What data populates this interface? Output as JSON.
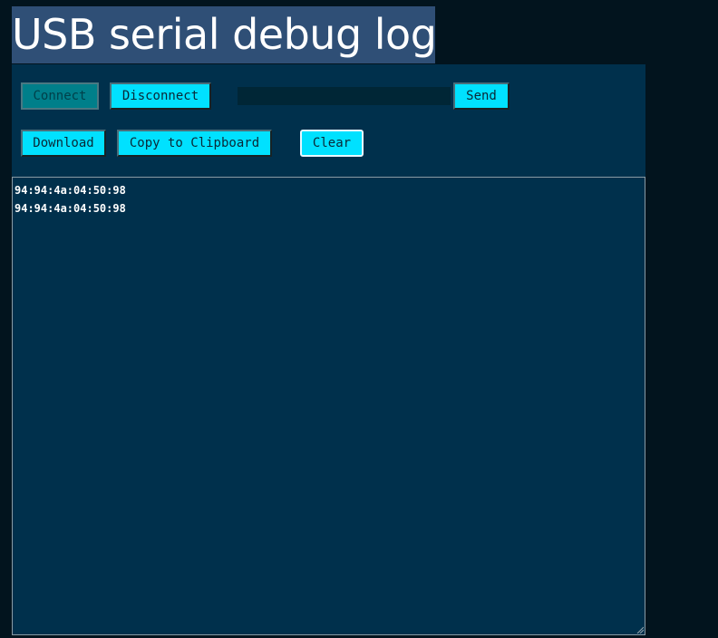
{
  "page": {
    "title": "USB serial debug log"
  },
  "controls": {
    "connect_label": "Connect",
    "disconnect_label": "Disconnect",
    "send_input_value": "",
    "send_label": "Send",
    "download_label": "Download",
    "copy_label": "Copy to Clipboard",
    "clear_label": "Clear"
  },
  "log": {
    "lines": [
      "94:94:4a:04:50:98",
      "94:94:4a:04:50:98"
    ]
  },
  "colors": {
    "page_background": "#02141e",
    "panel_background": "#00304c",
    "title_highlight": "#2f4f76",
    "button_accent": "#00e1ff",
    "button_disabled": "#007f8a"
  },
  "icons": {
    "resize_grip": "resize-grip-icon"
  }
}
